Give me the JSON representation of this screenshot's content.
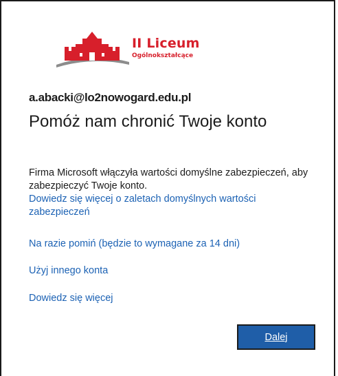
{
  "logo": {
    "name": "II Liceum",
    "subtitle": "Ogólnokształcące",
    "colors": {
      "red": "#d71f2b",
      "grey": "#8c8c8c"
    }
  },
  "account": {
    "email": "a.abacki@lo2nowogard.edu.pl"
  },
  "heading": "Pomóż nam chronić Twoje konto",
  "description": "Firma Microsoft włączyła wartości domyślne zabezpieczeń, aby zabezpieczyć Twoje konto.",
  "links": {
    "learn_defaults": "Dowiedz się więcej o zaletach domyślnych wartości zabezpieczeń",
    "skip": "Na razie pomiń (będzie to wymagane za 14 dni)",
    "other_account": "Użyj innego konta",
    "learn_more": "Dowiedz się więcej"
  },
  "buttons": {
    "next": "Dalej"
  },
  "colors": {
    "link": "#1c62b4",
    "button": "#1f5ea8",
    "text": "#1b1b1b"
  }
}
